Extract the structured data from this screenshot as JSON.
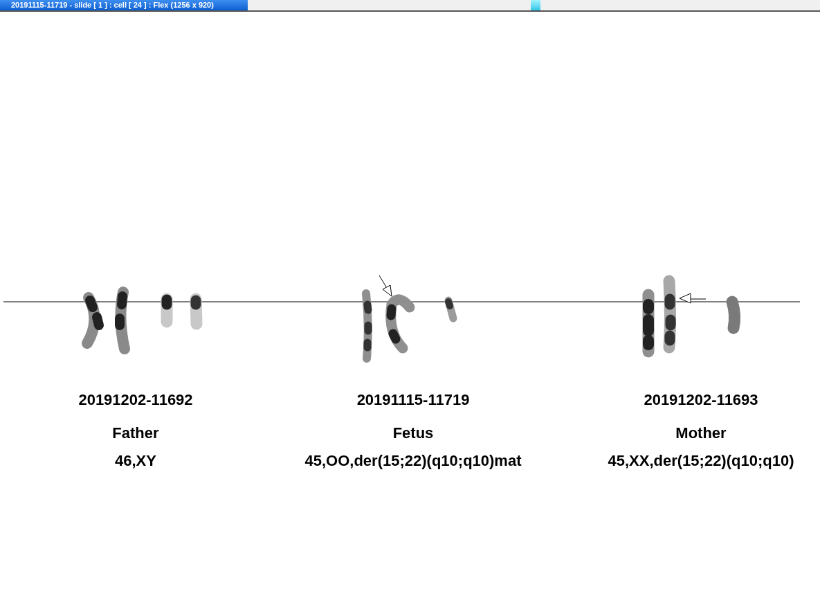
{
  "window": {
    "title": "20191115-11719 - slide [ 1 ] : cell [ 24 ] : Flex (1256 x 920)"
  },
  "panels": [
    {
      "sample_id": "20191202-11692",
      "relation": "Father",
      "karyotype": "46,XY"
    },
    {
      "sample_id": "20191115-11719",
      "relation": "Fetus",
      "karyotype": "45,OO,der(15;22)(q10;q10)mat"
    },
    {
      "sample_id": "20191202-11693",
      "relation": "Mother",
      "karyotype": "45,XX,der(15;22)(q10;q10)"
    }
  ]
}
